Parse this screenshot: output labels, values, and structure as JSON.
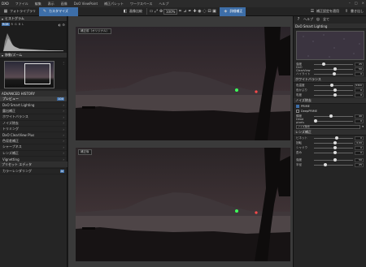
{
  "menubar": {
    "app": "DXO",
    "items": [
      "ファイル",
      "編集",
      "表示",
      "画像",
      "DxO ViewPoint",
      "補正パレット",
      "ワークスペース",
      "ヘルプ"
    ]
  },
  "toolbar": {
    "photolibrary_tab": "フォトライブラリ",
    "customize_tab": "カスタマイズ",
    "compare_label": "画像比較",
    "zoom_value": "100%",
    "apply_preset_label": "補正設定を適用",
    "export_label": "書き出し",
    "active_tab_label": "詳細補正"
  },
  "left": {
    "histogram_title": "ヒストグラム",
    "hist_modes": [
      "RGB",
      "R",
      "G",
      "B",
      "L"
    ],
    "navigator_title": "移動/ズーム",
    "advanced_history_title": "ADVANCED HISTORY",
    "history_items": [
      {
        "label": "プレビュー",
        "value": "100"
      },
      {
        "label": "DxO Smart Lighting"
      },
      {
        "label": "露出補正"
      },
      {
        "label": "ホワイトバランス"
      },
      {
        "label": "ノイズ除去"
      },
      {
        "label": "トリミング"
      },
      {
        "label": "DxO ClearView Plus"
      },
      {
        "label": "色収差補正"
      },
      {
        "label": "シャープネス"
      },
      {
        "label": "レンズ補正"
      },
      {
        "label": "Vignetting"
      },
      {
        "label": "マイクロコントラスト"
      },
      {
        "label": "カラーレンダリング",
        "value": "Ai"
      }
    ],
    "presets_title": "プリセット エディタ"
  },
  "center": {
    "top_label": "補正前（オリジナル）",
    "bottom_label": "補正後"
  },
  "right": {
    "top_buttons": [
      "ヘルプ",
      "全て"
    ],
    "tone_section": "DxO Smart Lighting",
    "rows1": [
      {
        "label": "強度",
        "value": "25"
      },
      {
        "label": "DxO ClearView",
        "value": "50"
      },
      {
        "label": "ハイライト",
        "value": "0"
      }
    ],
    "wb_section": "ホワイトバランス",
    "rows2": [
      {
        "label": "色温度",
        "value": "5300"
      },
      {
        "label": "色かぶり",
        "value": "0"
      },
      {
        "label": "彩度",
        "value": "0"
      }
    ],
    "noise_section": "ノイズ除去",
    "noise_options": [
      "PRIME",
      "DeepPRIME"
    ],
    "rows3": [
      {
        "label": "輝度",
        "value": "40"
      },
      {
        "label": "Dead pixels",
        "value": "0"
      }
    ],
    "dd_value": "ノイズ除去",
    "lens_section": "レンズ補正",
    "rows4": [
      {
        "label": "ビネット",
        "value": "0"
      },
      {
        "label": "回転",
        "value": "0.00"
      },
      {
        "label": "シャドウ",
        "value": "0"
      },
      {
        "label": "歪み",
        "value": "0"
      }
    ],
    "rows5": [
      {
        "label": "強度",
        "value": "50"
      },
      {
        "label": "半径",
        "value": "25"
      }
    ]
  }
}
